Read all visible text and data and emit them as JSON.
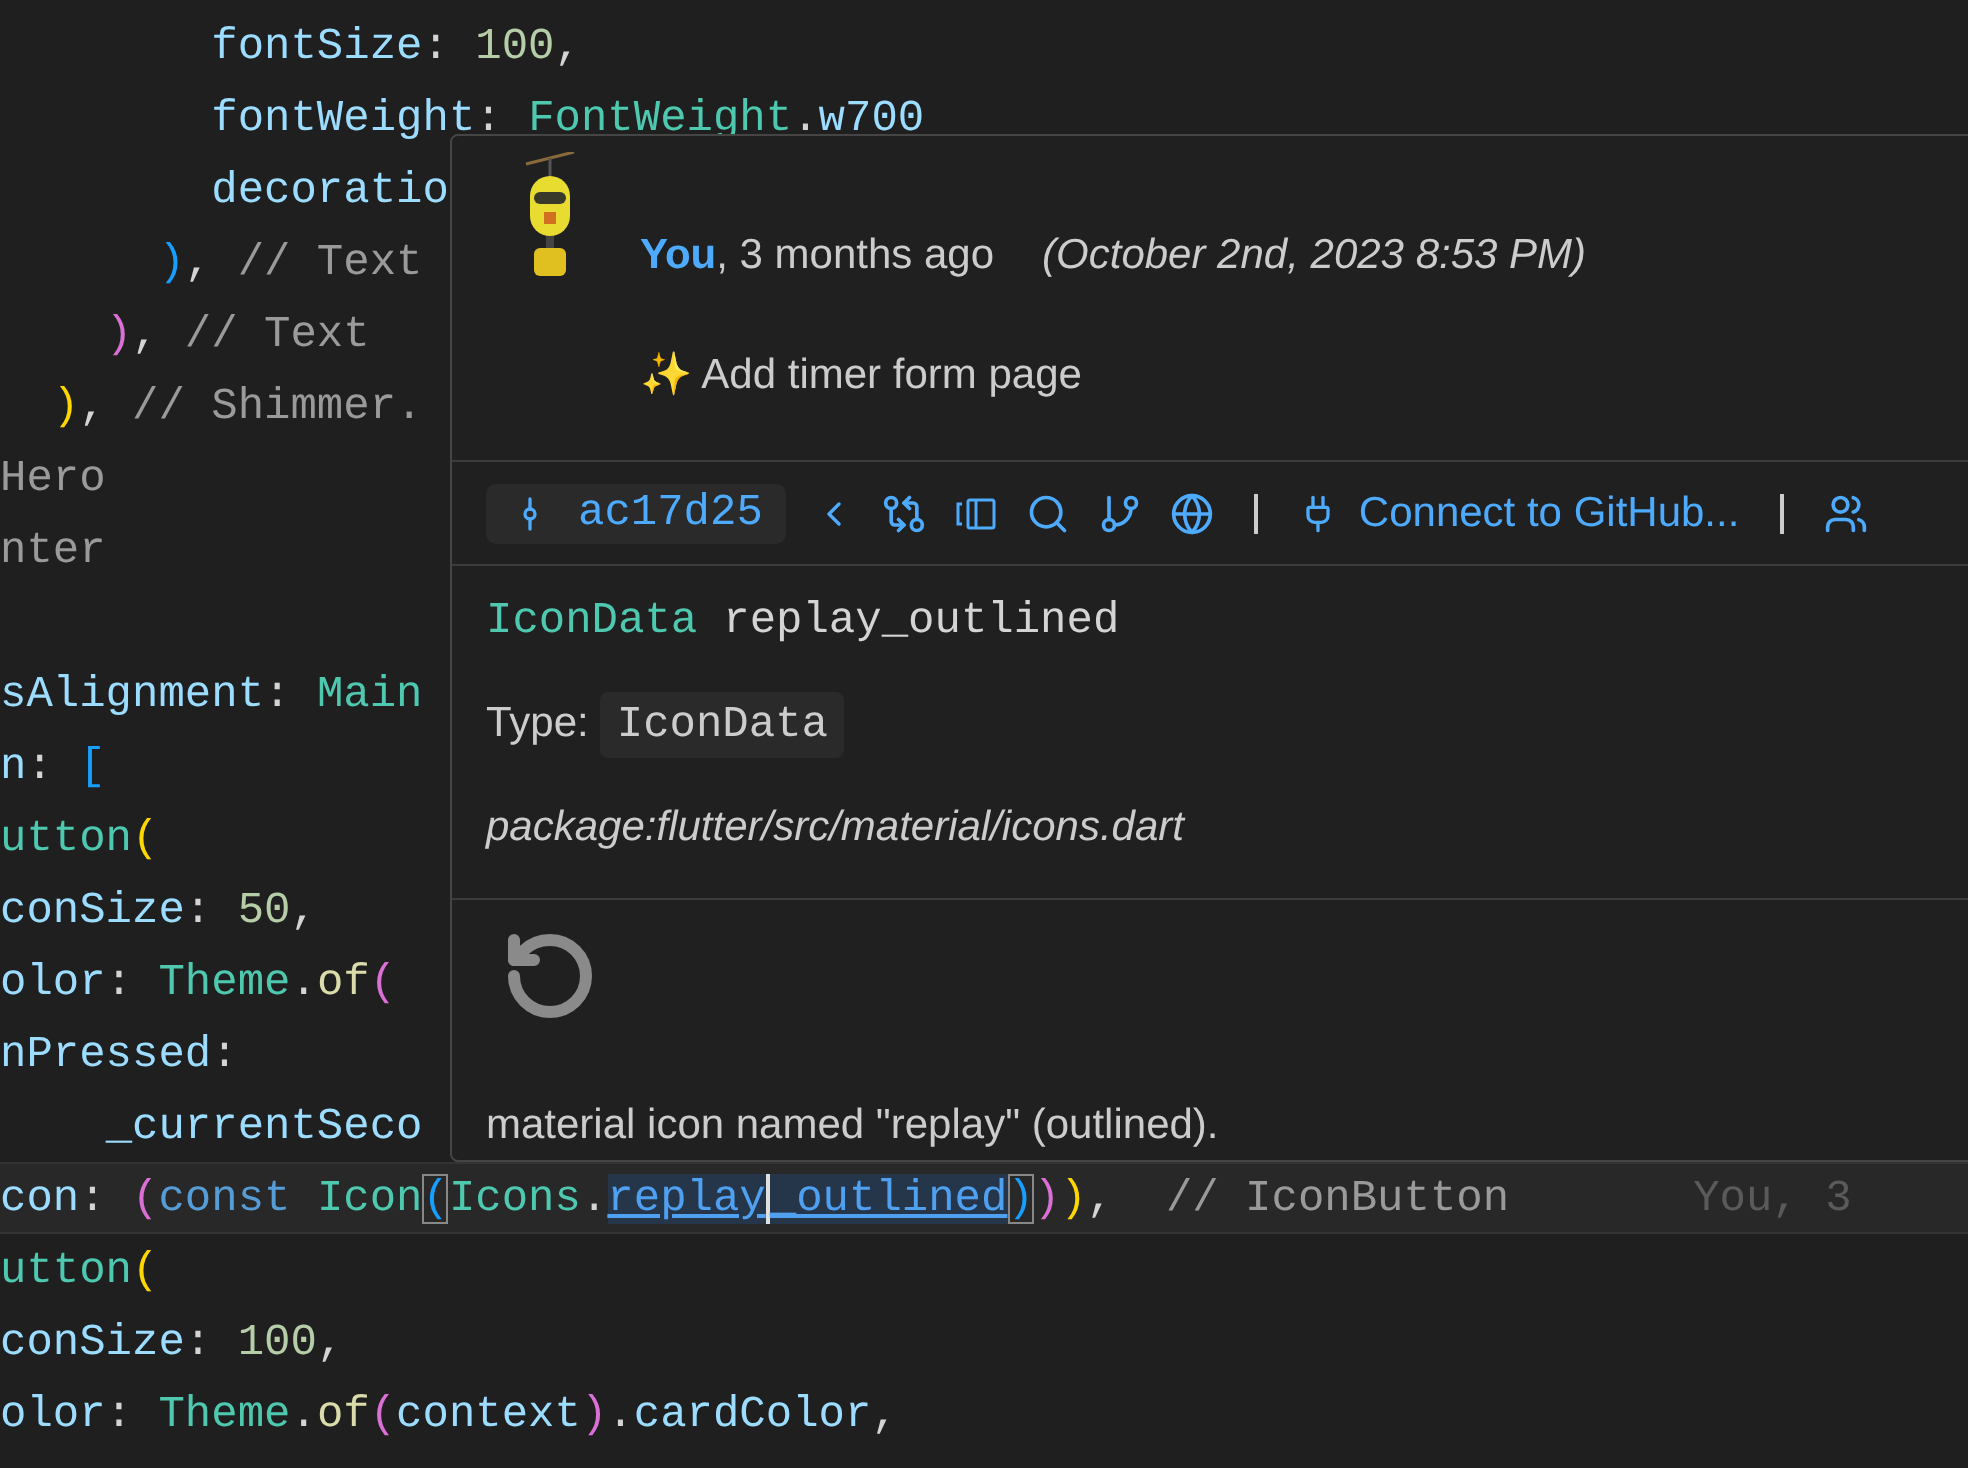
{
  "editor": {
    "lines": [
      {
        "tokens": [
          {
            "text": "        fontSize",
            "kind": "prop"
          },
          {
            "text": ": ",
            "kind": "punc"
          },
          {
            "text": "100",
            "kind": "num"
          },
          {
            "text": ",",
            "kind": "punc"
          }
        ]
      },
      {
        "tokens": [
          {
            "text": "        fontWeight",
            "kind": "prop"
          },
          {
            "text": ": ",
            "kind": "punc"
          },
          {
            "text": "FontWeight",
            "kind": "cls"
          },
          {
            "text": ".",
            "kind": "punc"
          },
          {
            "text": "w700",
            "kind": "prop"
          }
        ]
      },
      {
        "tokens": [
          {
            "text": "        decoratio",
            "kind": "prop"
          }
        ]
      },
      {
        "tokens": [
          {
            "text": "      )",
            "kind": "b3"
          },
          {
            "text": ", ",
            "kind": "punc"
          },
          {
            "text": "// Text",
            "kind": "comment"
          }
        ]
      },
      {
        "tokens": [
          {
            "text": "    )",
            "kind": "b2"
          },
          {
            "text": ", ",
            "kind": "punc"
          },
          {
            "text": "// Text",
            "kind": "comment"
          }
        ]
      },
      {
        "tokens": [
          {
            "text": "  )",
            "kind": "b1"
          },
          {
            "text": ", ",
            "kind": "punc"
          },
          {
            "text": "// Shimmer.",
            "kind": "comment"
          }
        ]
      },
      {
        "tokens": [
          {
            "text": "Hero",
            "kind": "comment"
          }
        ]
      },
      {
        "tokens": [
          {
            "text": "nter",
            "kind": "comment"
          }
        ]
      },
      {
        "kind": "blank"
      },
      {
        "tokens": [
          {
            "text": "sAlignment",
            "kind": "prop"
          },
          {
            "text": ": ",
            "kind": "punc"
          },
          {
            "text": "Main",
            "kind": "cls"
          }
        ]
      },
      {
        "tokens": [
          {
            "text": "n",
            "kind": "prop"
          },
          {
            "text": ": ",
            "kind": "punc"
          },
          {
            "text": "[",
            "kind": "b3"
          }
        ]
      },
      {
        "tokens": [
          {
            "text": "utton",
            "kind": "cls"
          },
          {
            "text": "(",
            "kind": "b1"
          }
        ]
      },
      {
        "tokens": [
          {
            "text": "conSize",
            "kind": "prop"
          },
          {
            "text": ": ",
            "kind": "punc"
          },
          {
            "text": "50",
            "kind": "num"
          },
          {
            "text": ",",
            "kind": "punc"
          }
        ]
      },
      {
        "tokens": [
          {
            "text": "olor",
            "kind": "prop"
          },
          {
            "text": ": ",
            "kind": "punc"
          },
          {
            "text": "Theme",
            "kind": "cls"
          },
          {
            "text": ".",
            "kind": "punc"
          },
          {
            "text": "of",
            "kind": "fn"
          },
          {
            "text": "(",
            "kind": "b2"
          }
        ]
      },
      {
        "tokens": [
          {
            "text": "nPressed",
            "kind": "prop"
          },
          {
            "text": ":",
            "kind": "punc"
          }
        ]
      },
      {
        "tokens": [
          {
            "text": "    _currentSeco",
            "kind": "prop"
          }
        ]
      },
      {
        "current": true,
        "blame": "You, 3",
        "tokens": [
          {
            "text": "con",
            "kind": "prop"
          },
          {
            "text": ": ",
            "kind": "punc"
          },
          {
            "text": "(",
            "kind": "b2"
          },
          {
            "text": "const ",
            "kind": "kw"
          },
          {
            "text": "Icon",
            "kind": "cls"
          },
          {
            "text": "(",
            "kind": "b3",
            "matched": true
          },
          {
            "text": "Icons",
            "kind": "cls"
          },
          {
            "text": ".",
            "kind": "punc"
          },
          {
            "text": "replay",
            "kind": "link"
          },
          {
            "text": "_outlined",
            "kind": "link",
            "caret": true
          },
          {
            "text": ")",
            "kind": "b3",
            "matched": true
          },
          {
            "text": ")",
            "kind": "b2"
          },
          {
            "text": ")",
            "kind": "b1"
          },
          {
            "text": ",  ",
            "kind": "punc"
          },
          {
            "text": "// IconButton",
            "kind": "comment"
          }
        ]
      },
      {
        "tokens": [
          {
            "text": "utton",
            "kind": "cls"
          },
          {
            "text": "(",
            "kind": "b1"
          }
        ]
      },
      {
        "tokens": [
          {
            "text": "conSize",
            "kind": "prop"
          },
          {
            "text": ": ",
            "kind": "punc"
          },
          {
            "text": "100",
            "kind": "num"
          },
          {
            "text": ",",
            "kind": "punc"
          }
        ]
      },
      {
        "tokens": [
          {
            "text": "olor",
            "kind": "prop"
          },
          {
            "text": ": ",
            "kind": "punc"
          },
          {
            "text": "Theme",
            "kind": "cls"
          },
          {
            "text": ".",
            "kind": "punc"
          },
          {
            "text": "of",
            "kind": "fn"
          },
          {
            "text": "(",
            "kind": "b2"
          },
          {
            "text": "context",
            "kind": "var"
          },
          {
            "text": ")",
            "kind": "b2"
          },
          {
            "text": ".",
            "kind": "punc"
          },
          {
            "text": "cardColor",
            "kind": "prop"
          },
          {
            "text": ",",
            "kind": "punc"
          }
        ]
      }
    ]
  },
  "hover": {
    "commit": {
      "byline": "**You**, 3 months ago",
      "date": "(October 2nd, 2023 8:53 PM)",
      "message": "✨ Add timer form page"
    },
    "toolbar": {
      "sha": "ac17d25",
      "connect": "Connect to GitHub..."
    },
    "signature": [
      {
        "text": "IconData",
        "kind": "cls"
      },
      {
        "text": "replay_outlined",
        "kind": "plain"
      }
    ],
    "type_label": "Type:",
    "type_value": "IconData",
    "source": "package:flutter/src/material/icons.dart",
    "description": "material icon named \"replay\" (outlined)."
  }
}
